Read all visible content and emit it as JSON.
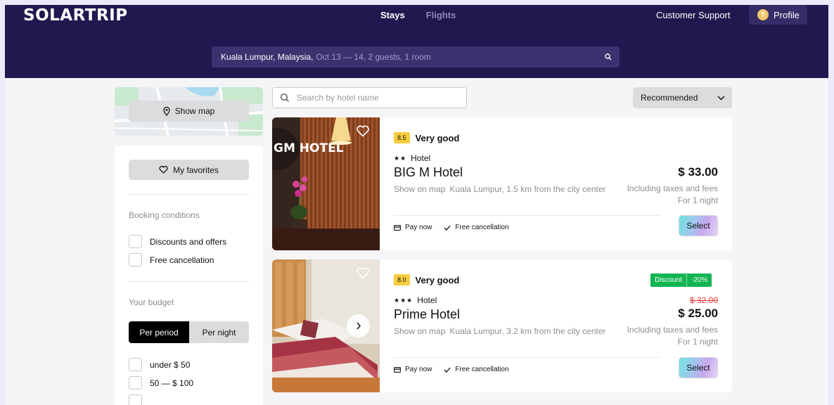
{
  "header": {
    "logo": "SOLARTRIP",
    "nav": {
      "stays": "Stays",
      "flights": "Flights"
    },
    "support": "Customer Support",
    "profile": {
      "initial": "T",
      "label": "Profile"
    },
    "search": {
      "place": "Kuala Lumpur, Malaysia,",
      "details": "Oct 13 — 14, 2 guests, 1 room"
    }
  },
  "sidebar": {
    "show_map": "Show map",
    "favorites": "My favorites",
    "booking_title": "Booking conditions",
    "booking_options": [
      "Discounts and offers",
      "Free cancellation"
    ],
    "budget_title": "Your budget",
    "budget_toggle": {
      "active": "Per period",
      "inactive": "Per night"
    },
    "budget_options": [
      "under $ 50",
      "50 — $ 100"
    ]
  },
  "toolbar": {
    "search_placeholder": "Search by hotel name",
    "sort_label": "Recommended"
  },
  "hotels": [
    {
      "rating": "8.5",
      "rating_text": "Very good",
      "stars": "★★",
      "type": "Hotel",
      "name": "BIG M Hotel",
      "show_on_map": "Show on map",
      "location": "Kuala Lumpur, 1.5 km from the city center",
      "price": "$ 33.00",
      "taxes": "Including taxes and fees",
      "nights": "For 1 night",
      "pay_now": "Pay now",
      "free_cancel": "Free cancellation",
      "select": "Select",
      "image_sign": "GM HOTEL"
    },
    {
      "rating": "8.0",
      "rating_text": "Very good",
      "stars": "★★★",
      "type": "Hotel",
      "name": "Prime Hotel",
      "show_on_map": "Show on map",
      "location": "Kuala Lumpur, 3.2 km from the city center",
      "discount_label": "Discount",
      "discount_value": "-20%",
      "old_price": "$ 32.00",
      "price": "$ 25.00",
      "taxes": "Including taxes and fees",
      "nights": "For 1 night",
      "pay_now": "Pay now",
      "free_cancel": "Free cancellation",
      "select": "Select"
    }
  ],
  "colors": {
    "header_bg": "#22184f",
    "rating_badge": "#f7cc3d",
    "discount": "#12b552",
    "old_price": "#e33b3b"
  },
  "icons": [
    "search-icon",
    "location-pin-icon",
    "heart-icon",
    "chevron-down-icon",
    "card-icon",
    "check-icon",
    "chevron-right-icon"
  ]
}
